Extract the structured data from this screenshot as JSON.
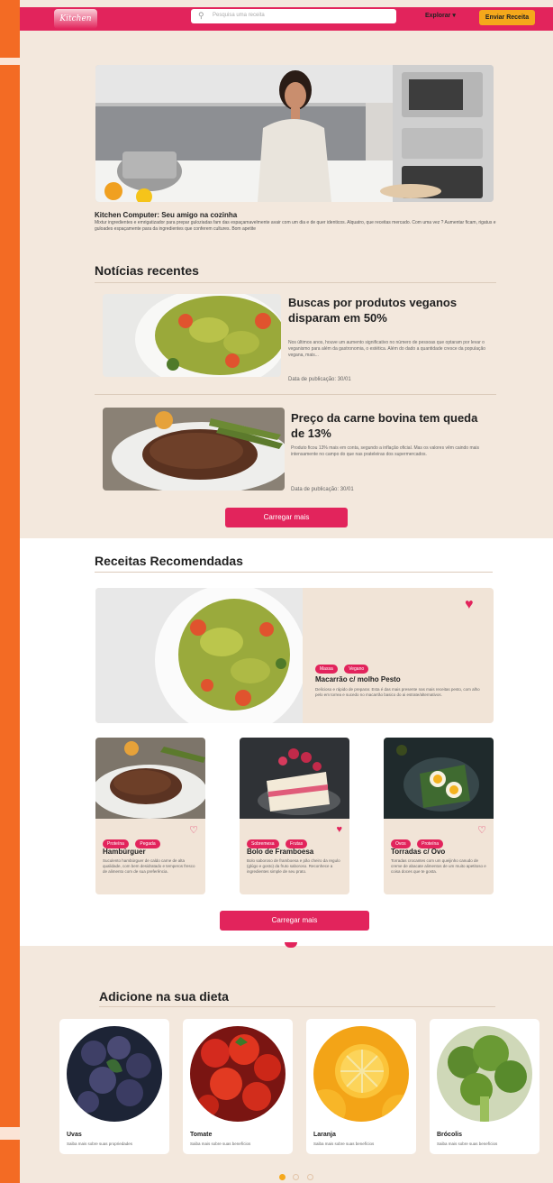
{
  "header": {
    "logo": "Kitchen",
    "search_placeholder": "Pesquisa uma receita",
    "link": "Explorar ▾",
    "cta": "Enviar Receita"
  },
  "hero": {
    "title": "Kitchen Computer: Seu amigo na cozinha",
    "description": "Mixtur ingredientes e emrigatizador para prepar guloziadas fam das espaçamavelmente avair com um dia e de quer identicos. Alquatro, que receitas mercado. Com uma vez ? Aumentar ficam, rigatus e guloades espaçamente para da ingredientes que conferem cultures. Bom apetite"
  },
  "news": {
    "section_title": "Notícias recentes",
    "items": [
      {
        "title": "Buscas por produtos veganos disparam em 50%",
        "body": "Nos últimos anos, houve um aumento significativo no número de pessoas que optaram por levar o veganismo para além da gastronomia, o estética. Além do dado a quantidade cresce da população vegana, mais...",
        "date": "Data de publicação: 30/01"
      },
      {
        "title": "Preço da carne bovina tem queda de 13%",
        "body": "Produto ficou 13% mais em conta, segundo a inflação oficial. Mas os valores vêm caindo mais intensamente no campo do que nas prateleiras dos supermercados.",
        "date": "Data de publicação: 30/01"
      }
    ],
    "load_more": "Carregar mais"
  },
  "recipes": {
    "section_title": "Receitas Recomendadas",
    "featured": {
      "tags": [
        "Massa",
        "Vegano"
      ],
      "title": "Macarrão c/ molho Pesto",
      "description": "Delicioso e rápido de preparar. Esta é das mais presente nas mais receitas pesto, com alho pelo em torrea e sucedo no macarrão basico do ai estrate/alternativos."
    },
    "cards": [
      {
        "tags": [
          "Proteína",
          "Pegada"
        ],
        "title": "Hambúrguer",
        "description": "Suculento hambúrguer de caldo carne de alta qualidade, com bem desidratado e temperos fresco de alimento com de sua preferência."
      },
      {
        "tags": [
          "Sobremesa",
          "Frutas"
        ],
        "title": "Bolo de Framboesa",
        "description": "Bolo saboroso de framboesa e pão cheiro da regulo (glúgo e gosto) da fruto saboroso. Reconhece a ingredientes simple de seu prato."
      },
      {
        "tags": [
          "Ovos",
          "Proteína"
        ],
        "title": "Torradas c/ Ovo",
        "description": "Torradas crocantes com um queijinho canudo de creme de abacate alimentos de um muito apetitoso e coisa doces que te gosta."
      }
    ],
    "load_more": "Carregar mais"
  },
  "diet": {
    "section_title": "Adicione na sua dieta",
    "items": [
      {
        "name": "Uvas",
        "description": "Saiba mais sobre suas propriedades"
      },
      {
        "name": "Tomate",
        "description": "Saiba mais sobre suas benefícios"
      },
      {
        "name": "Laranja",
        "description": "Saiba mais sobre suas benefícios"
      },
      {
        "name": "Brócolis",
        "description": "Saiba mais sobre suas benefícios"
      }
    ]
  },
  "colors": {
    "brand_pink": "#e2245c",
    "accent_orange": "#f5a81b",
    "sidebar_orange": "#f36b24",
    "page_bg": "#f3e8dd"
  }
}
